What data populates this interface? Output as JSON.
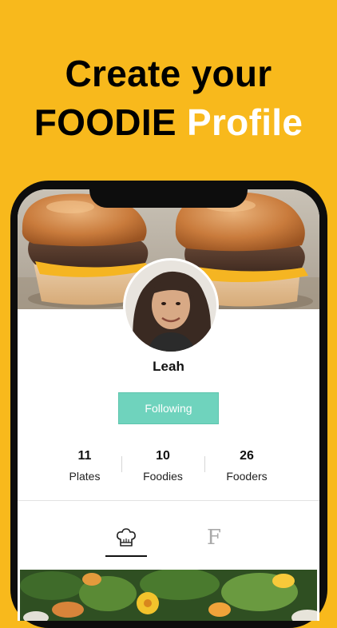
{
  "headline": {
    "line1": "Create your",
    "line2_dark": "FOODIE",
    "line2_white": "Profile"
  },
  "profile": {
    "name": "Leah",
    "follow_button_label": "Following"
  },
  "stats": [
    {
      "value": "11",
      "label": "Plates"
    },
    {
      "value": "10",
      "label": "Foodies"
    },
    {
      "value": "26",
      "label": "Fooders"
    }
  ],
  "tabs": [
    {
      "icon": "chef-hat-icon",
      "active": true
    },
    {
      "icon": "f-letter-icon",
      "glyph": "F",
      "active": false
    }
  ],
  "colors": {
    "background": "#F8B91C",
    "follow_button": "#6FD3BD",
    "phone_frame": "#0d0d0d"
  }
}
